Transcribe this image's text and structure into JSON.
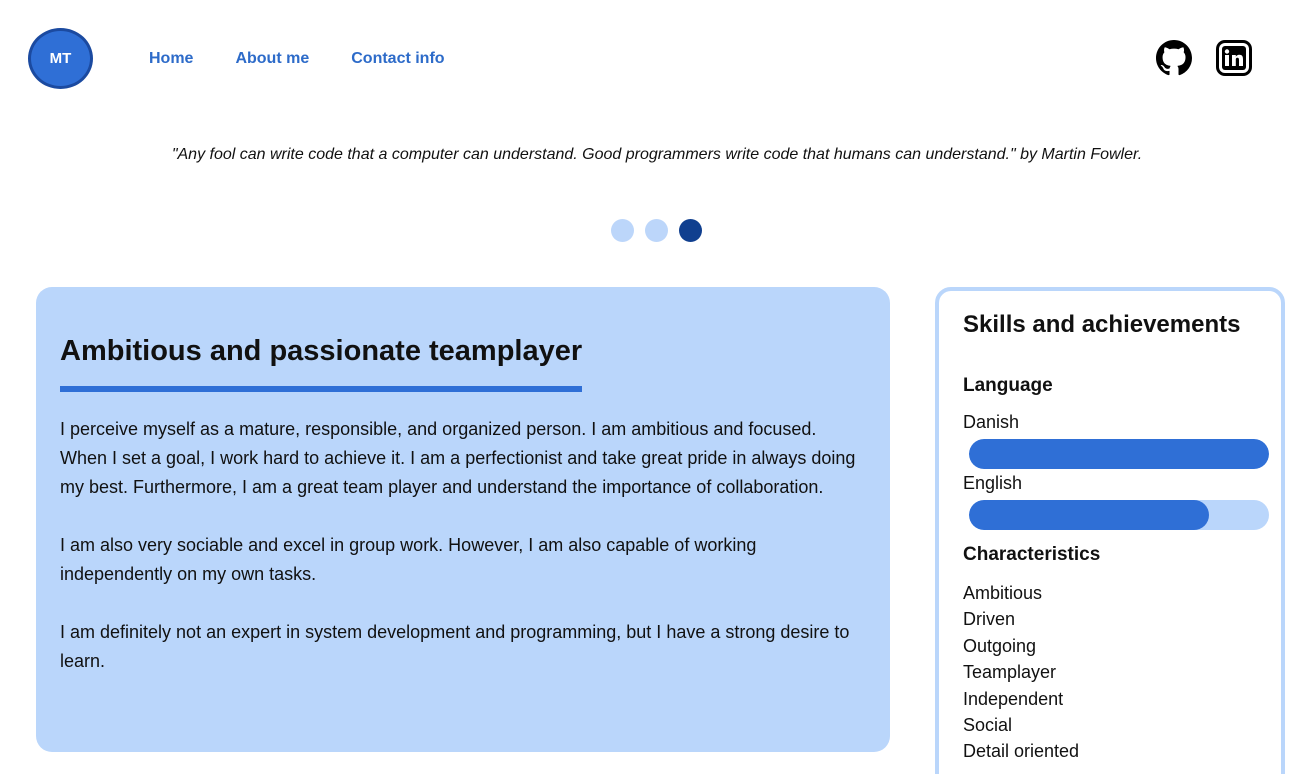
{
  "header": {
    "logo_text": "MT",
    "nav": [
      "Home",
      "About me",
      "Contact info"
    ],
    "social": [
      {
        "name": "github-icon"
      },
      {
        "name": "linkedin-icon"
      }
    ]
  },
  "quote": "\"Any fool can write code that a computer can understand. Good programmers write code that humans can understand.\" by Martin Fowler.",
  "carousel": {
    "count": 3,
    "active_index": 2
  },
  "about": {
    "title": "Ambitious and passionate teamplayer",
    "paragraphs": [
      "I perceive myself as a mature, responsible, and organized person. I am ambitious and focused. When I set a goal, I work hard to achieve it. I am a perfectionist and take great pride in always doing my best. Furthermore, I am a great team player and understand the importance of collaboration.",
      "I am also very sociable and excel in group work. However, I am also capable of working independently on my own tasks.",
      "I am definitely not an expert in system development and programming, but I have a strong desire to learn."
    ]
  },
  "skills": {
    "title": "Skills and achievements",
    "language_heading": "Language",
    "languages": [
      {
        "name": "Danish",
        "level": 1.0
      },
      {
        "name": "English",
        "level": 0.8
      }
    ],
    "characteristics_heading": "Characteristics",
    "characteristics": [
      "Ambitious",
      "Driven",
      "Outgoing",
      "Teamplayer",
      "Independent",
      "Social",
      "Detail oriented"
    ]
  },
  "colors": {
    "accent": "#2f6fd6",
    "accent_light": "#bad6fb",
    "dot_active": "#103f8f",
    "nav_link": "#2d6bc9"
  }
}
